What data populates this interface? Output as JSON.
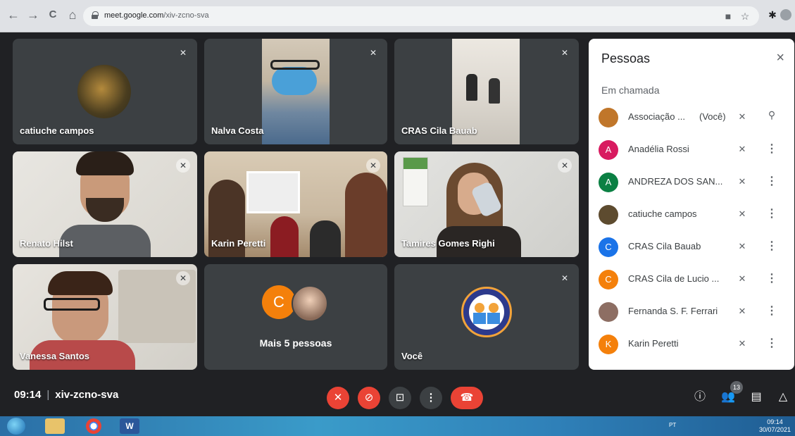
{
  "browser": {
    "url_host": "meet.google.com",
    "url_path": "/xiv-zcno-sva",
    "back": "←",
    "forward": "→",
    "reload": "C",
    "home": "⌂"
  },
  "tiles": [
    {
      "name": "catiuche campos"
    },
    {
      "name": "Nalva Costa"
    },
    {
      "name": "CRAS Cila Bauab"
    },
    {
      "name": "Renato Hilst"
    },
    {
      "name": "Karin Peretti"
    },
    {
      "name": "Tamires Gomes Righi"
    },
    {
      "name": "Vanessa Santos"
    },
    {
      "name": "Mais 5 pessoas",
      "avatar_letter": "C"
    },
    {
      "name": "Você"
    }
  ],
  "panel": {
    "title": "Pessoas",
    "subtitle": "Em chamada",
    "close": "×",
    "people": [
      {
        "name": "Associação ...",
        "you": "(Você)",
        "avatar": "",
        "color": "#c0762a"
      },
      {
        "name": "Anadélia Rossi",
        "avatar": "A",
        "color": "#d81b60"
      },
      {
        "name": "ANDREZA DOS SAN...",
        "avatar": "A",
        "color": "#0b8043"
      },
      {
        "name": "catiuche campos",
        "avatar": "",
        "color": "#5d4b2f"
      },
      {
        "name": "CRAS Cila Bauab",
        "avatar": "C",
        "color": "#1a73e8"
      },
      {
        "name": "CRAS Cila de Lucio ...",
        "avatar": "C",
        "color": "#f4800b"
      },
      {
        "name": "Fernanda S. F. Ferrari",
        "avatar": "",
        "color": "#8d6e63"
      },
      {
        "name": "Karin Peretti",
        "avatar": "K",
        "color": "#f4800b"
      }
    ]
  },
  "bottom": {
    "time": "09:14",
    "meeting_code": "xiv-zcno-sva",
    "participants_count": "13"
  },
  "taskbar": {
    "clock_time": "09:14",
    "clock_date": "30/07/2021",
    "tray_lang": "PT"
  },
  "colors": {
    "meet_red": "#ea4335",
    "tile_bg": "#3c4043",
    "stage_bg": "#202124"
  }
}
